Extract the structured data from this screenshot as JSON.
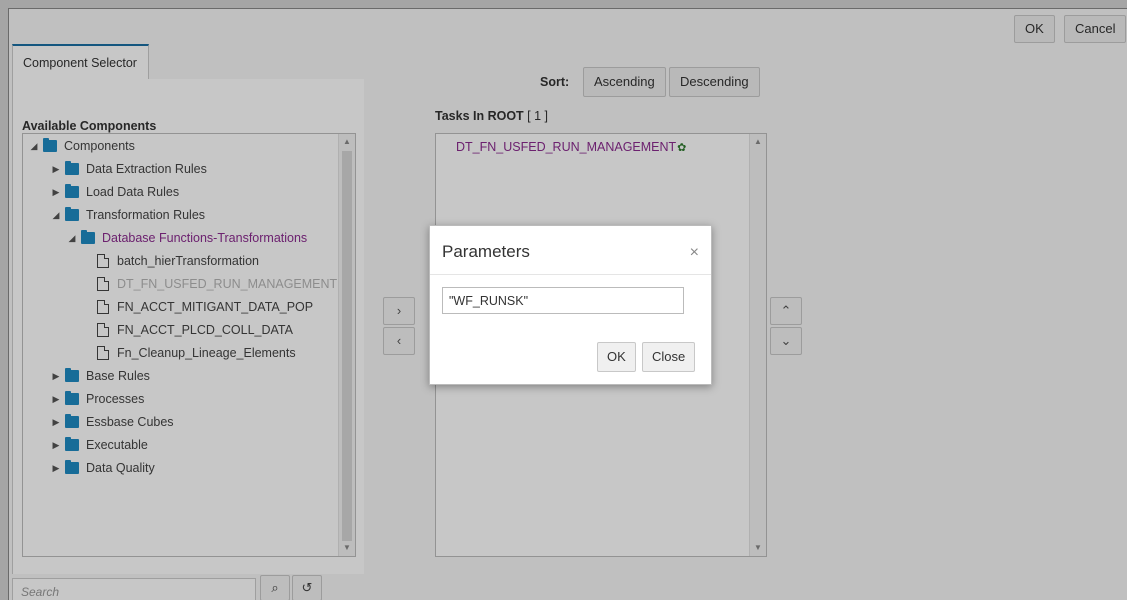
{
  "top_buttons": {
    "ok": "OK",
    "cancel": "Cancel"
  },
  "tab": {
    "label": "Component Selector"
  },
  "available": {
    "heading": "Available Components",
    "tree": [
      {
        "label": "Components",
        "type": "folder",
        "toggle": "expanded",
        "level": 0
      },
      {
        "label": "Data Extraction Rules",
        "type": "folder",
        "toggle": "collapsed",
        "level": 1
      },
      {
        "label": "Load Data Rules",
        "type": "folder",
        "toggle": "collapsed",
        "level": 1
      },
      {
        "label": "Transformation Rules",
        "type": "folder",
        "toggle": "expanded",
        "level": 1
      },
      {
        "label": "Database Functions-Transformations",
        "type": "folder-active",
        "toggle": "expanded",
        "level": 2
      },
      {
        "label": "batch_hierTransformation",
        "type": "doc",
        "level": 3
      },
      {
        "label": "DT_FN_USFED_RUN_MANAGEMENT",
        "type": "doc-disabled",
        "level": 3
      },
      {
        "label": "FN_ACCT_MITIGANT_DATA_POP",
        "type": "doc",
        "level": 3
      },
      {
        "label": "FN_ACCT_PLCD_COLL_DATA",
        "type": "doc",
        "level": 3
      },
      {
        "label": "Fn_Cleanup_Lineage_Elements",
        "type": "doc",
        "level": 3
      },
      {
        "label": "Base Rules",
        "type": "folder",
        "toggle": "collapsed",
        "level": 1
      },
      {
        "label": "Processes",
        "type": "folder",
        "toggle": "collapsed",
        "level": 1
      },
      {
        "label": "Essbase Cubes",
        "type": "folder",
        "toggle": "collapsed",
        "level": 1
      },
      {
        "label": "Executable",
        "type": "folder",
        "toggle": "collapsed",
        "level": 1
      },
      {
        "label": "Data Quality",
        "type": "folder",
        "toggle": "collapsed",
        "level": 1
      }
    ]
  },
  "move": {
    "right": "›",
    "left": "‹"
  },
  "sort": {
    "label": "Sort:",
    "ascending": "Ascending",
    "descending": "Descending"
  },
  "tasks": {
    "heading": "Tasks In ROOT",
    "count": "[ 1 ]",
    "items": [
      {
        "label": "DT_FN_USFED_RUN_MANAGEMENT"
      }
    ]
  },
  "order": {
    "up": "⌃",
    "down": "⌄"
  },
  "search": {
    "placeholder": "Search"
  },
  "dialog": {
    "title": "Parameters",
    "close_glyph": "×",
    "input_value": "\"WF_RUNSK\"",
    "ok": "OK",
    "close": "Close"
  },
  "icons": {
    "folder_color": "#1e8bc3",
    "active_color": "#8b2b8f",
    "gear_color": "#2d7a2d"
  }
}
